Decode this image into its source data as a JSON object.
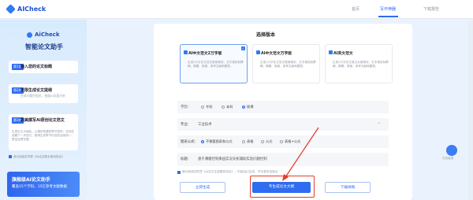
{
  "app": {
    "brand": "AICheck"
  },
  "nav": {
    "items": [
      "首页",
      "写作神器",
      "下载报告"
    ]
  },
  "sidebar": {
    "brand": "AiCheck",
    "title": "智能论文助手",
    "steps": [
      {
        "tag": "第1步",
        "head": "输入您的论文标题",
        "sub": "",
        "desc": ""
      },
      {
        "tag": "第2步",
        "head": "无限生成论文提纲",
        "sub": "生成与题目相关，依据AI全面分析",
        "desc": ""
      },
      {
        "tag": "第3步",
        "head": "完美撰写AI原创论文范文",
        "sub": "",
        "desc": "生成论文大纲后，以规划构建的章节结构，自动在选题下一步进行，使得生成章节内容的连续统一，更加连贯完整。"
      }
    ],
    "agree_text": "我已阅读并同意《AI论文助手使用协议》",
    "promo": {
      "title": "旗舰级AI论文助手",
      "sub": "覆盖15个学科、15亿参考文献数据"
    }
  },
  "panel": {
    "title": "选择版本",
    "cards": [
      {
        "title": "AI中文范文2万字版",
        "desc": "生成2万字论文范文提纲规划，文字规划拟撰稿，摘要、致谢、参考文献和图表。",
        "selected": true
      },
      {
        "title": "AI中文范文万字版",
        "desc": "生成1万字论文范文提纲规划，文字规划拟撰稿，摘要、致谢、参考文献和图表。",
        "selected": false
      },
      {
        "title": "AI英文范文",
        "desc": "生成1万字论文英文大纲规划，文字规划拟撰稿，摘要、致谢、参考文献和图表。",
        "selected": false
      }
    ],
    "degree": {
      "label": "学历:",
      "options": [
        "专科",
        "本科",
        "硕博"
      ],
      "selected": 2
    },
    "major": {
      "label": "专业:",
      "value": "工业技术"
    },
    "charts": {
      "label": "图表公式:",
      "options": [
        "不需要图表和公式",
        "表格",
        "公式",
        "表格+公式"
      ],
      "selected": 0
    },
    "title_field": {
      "label": "标题:",
      "value": "基于薄膜控制果园实况天机辅助实验问题控制"
    },
    "terms": "我已阅读并同意《AI论文生成服务协议》，内容由AI生成，不代表本站观点",
    "buttons": {
      "generate": "立即生成",
      "outline": "专生成论文大纲",
      "download": "下载样稿"
    }
  },
  "float": {
    "label": "在线客服"
  },
  "colors": {
    "accent": "#2f6cf0",
    "highlight": "#e23b2e"
  }
}
